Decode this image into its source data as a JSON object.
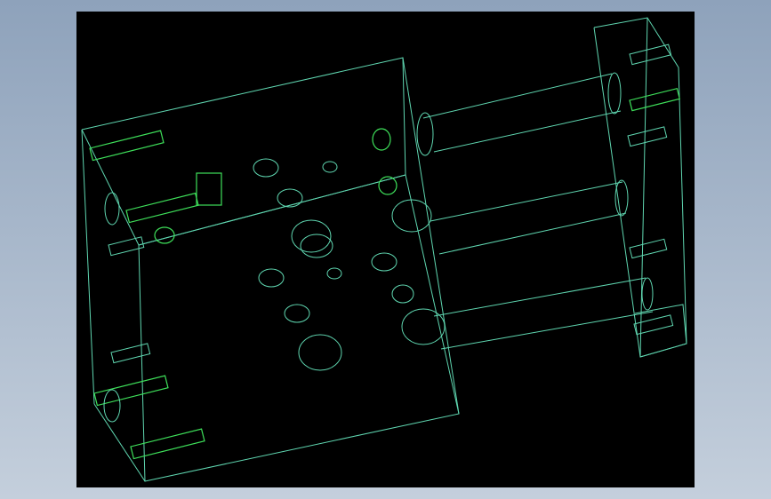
{
  "viewport": {
    "background": "#000000",
    "edge_color": "#5fd6b0",
    "pin_color": "#3ee05a",
    "render_mode": "wireframe",
    "model": "mold-base-assembly"
  },
  "frame": {
    "background_top": "#8ea2bb",
    "background_bottom": "#c4cfdc"
  }
}
